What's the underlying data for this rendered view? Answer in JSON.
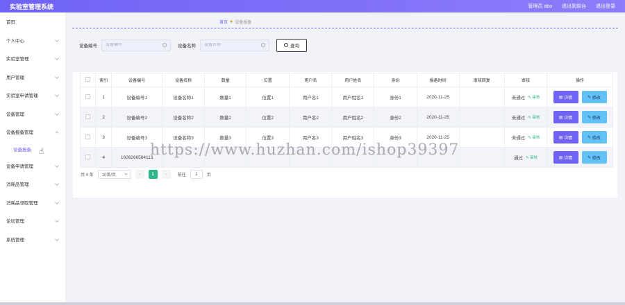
{
  "header": {
    "title": "实验室管理系统",
    "admin_label": "管理员 abo",
    "exit_to_frontend": "退出到前台",
    "logout": "退出登录"
  },
  "sidebar": {
    "items": [
      {
        "label": "首页"
      },
      {
        "label": "个人中心"
      },
      {
        "label": "实验室管理"
      },
      {
        "label": "用户管理"
      },
      {
        "label": "实验室申请管理"
      },
      {
        "label": "设备管理"
      },
      {
        "label": "设备报备管理"
      },
      {
        "label": "设备申请管理"
      },
      {
        "label": "消耗品管理"
      },
      {
        "label": "消耗品领取管理"
      },
      {
        "label": "论坛管理"
      },
      {
        "label": "系统管理"
      }
    ],
    "active_sub": "设备报备"
  },
  "breadcrumb": {
    "home": "首页",
    "current": "设备报备"
  },
  "search": {
    "code_label": "设备编号",
    "code_placeholder": "设备编号",
    "name_label": "设备名称",
    "name_placeholder": "设备名称",
    "query_button": "查询"
  },
  "table": {
    "headers": [
      "索引",
      "设备编号",
      "设备名称",
      "数量",
      "位置",
      "用户名",
      "用户姓名",
      "身份",
      "报备时间",
      "审核回复",
      "审核",
      "操作"
    ],
    "rows": [
      {
        "index": "1",
        "code": "设备编号1",
        "name": "设备名称1",
        "qty": "数量1",
        "location": "位置1",
        "username": "用户名1",
        "realname": "用户姓名1",
        "identity": "身份1",
        "time": "2020-11-25",
        "reply": "",
        "status": "未通过",
        "audit_link": "审核"
      },
      {
        "index": "2",
        "code": "设备编号2",
        "name": "设备名称2",
        "qty": "数量2",
        "location": "位置2",
        "username": "用户名2",
        "realname": "用户姓名2",
        "identity": "身份2",
        "time": "2020-11-25",
        "reply": "",
        "status": "未通过",
        "audit_link": "审核"
      },
      {
        "index": "3",
        "code": "设备编号3",
        "name": "设备名称3",
        "qty": "数量3",
        "location": "位置3",
        "username": "用户名3",
        "realname": "用户姓名3",
        "identity": "身份3",
        "time": "2020-11-25",
        "reply": "",
        "status": "未通过",
        "audit_link": "审核"
      },
      {
        "index": "4",
        "code": "1606266584113",
        "name": "",
        "qty": "",
        "location": "",
        "username": "",
        "realname": "",
        "identity": "",
        "time": "",
        "reply": "",
        "status": "通过",
        "audit_link": "审核"
      }
    ],
    "detail_button": "详情",
    "edit_button": "修改"
  },
  "pagination": {
    "total": "共 4 条",
    "page_size": "10条/页",
    "current_page": "1",
    "goto_prefix": "前往",
    "goto_value": "1",
    "goto_suffix": "页"
  },
  "watermark": "https://www.huzhan.com/ishop39397",
  "colors": {
    "primary": "#6f63f5",
    "edit_button": "#63c2f5",
    "success": "#2fb887"
  }
}
